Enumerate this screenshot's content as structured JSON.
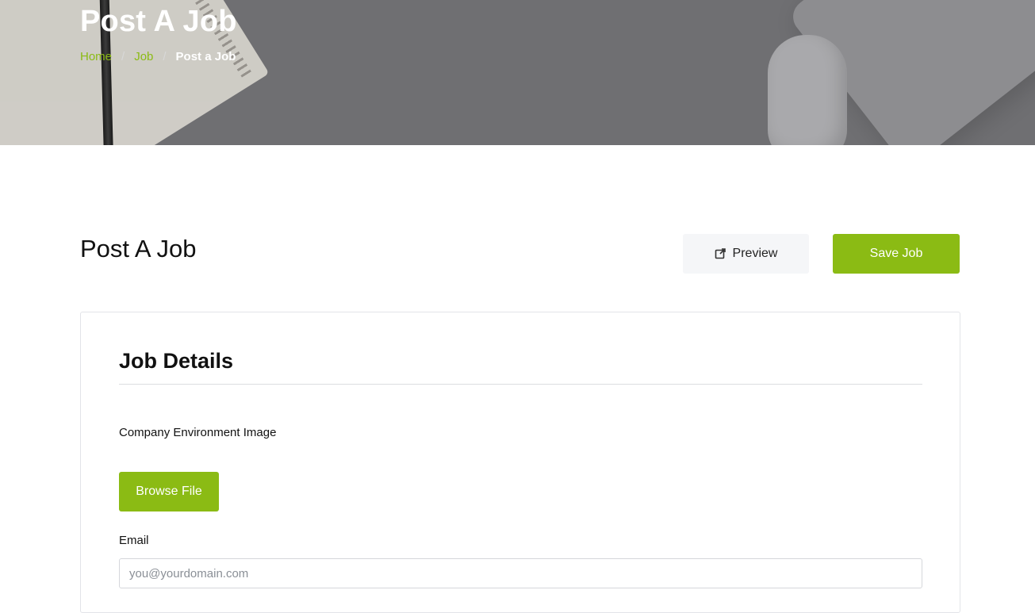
{
  "hero": {
    "title": "Post A Job",
    "breadcrumb": {
      "items": [
        "Home",
        "Job"
      ],
      "separator": "/",
      "current": "Post a Job"
    }
  },
  "header": {
    "page_title": "Post A Job",
    "preview_label": "Preview",
    "preview_icon": "external-link-icon",
    "save_label": "Save Job"
  },
  "job_details": {
    "section_title": "Job Details",
    "company_image_label": "Company Environment Image",
    "browse_label": "Browse File",
    "email_label": "Email",
    "email_placeholder": "you@yourdomain.com",
    "email_value": ""
  },
  "colors": {
    "accent": "#8bbb14",
    "hero_bg": "#6f6f72",
    "preview_bg": "#f5f6f8"
  }
}
